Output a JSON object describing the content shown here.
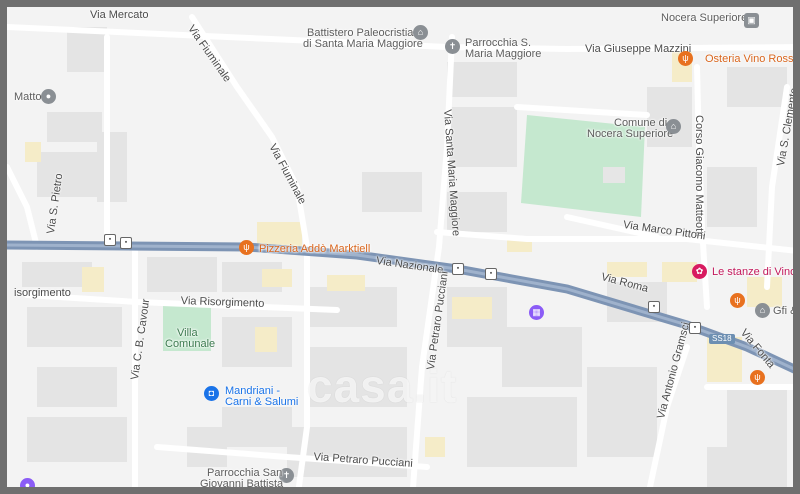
{
  "map": {
    "colors": {
      "background": "#f3f3f3",
      "main_road": "#7d94b4",
      "minor_road": "#ffffff",
      "park": "#c5e8cf",
      "buildings": "#e5e5e5",
      "frame": "#6f6f6f"
    },
    "streets": {
      "via_mercato": "Via Mercato",
      "via_fiuminale_1": "Via Fiuminale",
      "via_fiuminale_2": "Via Fiuminale",
      "via_giuseppe_mazzini": "Via Giuseppe Mazzini",
      "via_santa_maria_maggiore": "Via Santa Maria Maggiore",
      "corso_giacomo_matteotti": "Corso Giacomo Matteotti",
      "via_s_clemente": "Via S. Clemente",
      "via_s_pietro": "Via S. Pietro",
      "via_marco_pittoni": "Via Marco Pittoni",
      "via_nazionale": "Via Nazionale",
      "via_roma": "Via Roma",
      "via_risorgimento": "Via Risorgimento",
      "risorgimento_left": "isorgimento",
      "via_cb_cavour": "Via C. B. Cavour",
      "via_petraro_pucciani_v": "Via Petraro Pucciani",
      "via_petraro_pucciani_h": "Via Petraro Pucciani",
      "via_antonio_gramsci": "Via Antonio Gramsci",
      "via_fonta": "Via Fonta"
    },
    "places": {
      "nocera_superiore": "Nocera Superiore",
      "battistero_line1": "Battistero Paleocristiano",
      "battistero_line2": "di Santa Maria Maggiore",
      "parrocchia_s_line1": "Parrocchia S.",
      "parrocchia_s_line2": "Maria Maggiore",
      "osteria": "Osteria Vino Rosso",
      "matto": "Matto",
      "comune_line1": "Comune di",
      "comune_line2": "Nocera Superiore",
      "pizzeria": "Pizzeria Addò Marktiell",
      "le_stanze": "Le stanze di Vino Ro",
      "gfi": "Gfi &",
      "villa_line1": "Villa",
      "villa_line2": "Comunale",
      "mandriani_line1": "Mandriani -",
      "mandriani_line2": "Carni & Salumi",
      "parrocchia_sg_line1": "Parrocchia San",
      "parrocchia_sg_line2": "Giovanni Battista"
    },
    "road_shield": "SS18",
    "watermark": "casa.it"
  }
}
